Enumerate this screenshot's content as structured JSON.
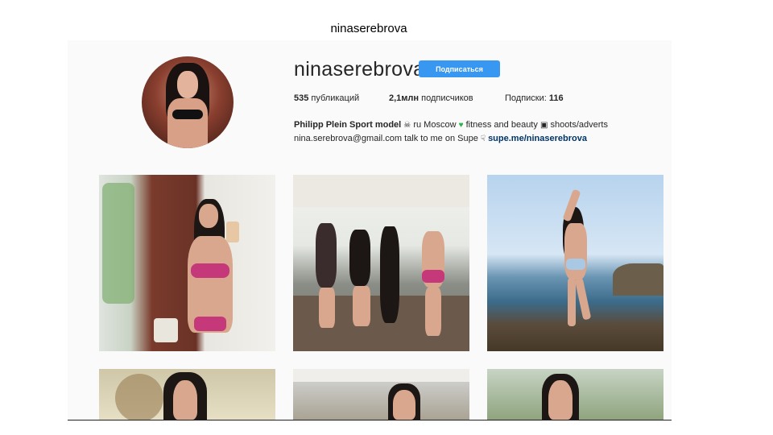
{
  "slide": {
    "title": "ninaserebrova"
  },
  "profile": {
    "username": "ninaserebrova",
    "follow_label": "Подписаться",
    "stats": {
      "posts": {
        "count": "535",
        "label": "публикаций"
      },
      "followers": {
        "count": "2,1млн",
        "label": "подписчиков"
      },
      "following": {
        "label": "Подписки:",
        "count": "116"
      }
    },
    "bio": {
      "name": "Philipp Plein Sport model",
      "line1_rest": "ru Moscow",
      "line1_tail": "fitness and beauty",
      "line1_end": "shoots/adverts",
      "line2_text": "nina.serebrova@gmail.com talk to me on Supe",
      "link": "supe.me/ninaserebrova"
    },
    "icons": {
      "skull": "skull-icon",
      "heart": "green-heart-icon",
      "camera": "camera-icon",
      "hand": "pointing-hand-icon"
    }
  },
  "posts": [
    {
      "name": "post-1",
      "kind": "photo"
    },
    {
      "name": "post-2",
      "kind": "video"
    },
    {
      "name": "post-3",
      "kind": "photo"
    },
    {
      "name": "post-4",
      "kind": "photo"
    },
    {
      "name": "post-5",
      "kind": "photo"
    },
    {
      "name": "post-6",
      "kind": "photo"
    }
  ],
  "colors": {
    "follow_button": "#3897f0",
    "link": "#003569",
    "heart": "#2bb34a"
  }
}
